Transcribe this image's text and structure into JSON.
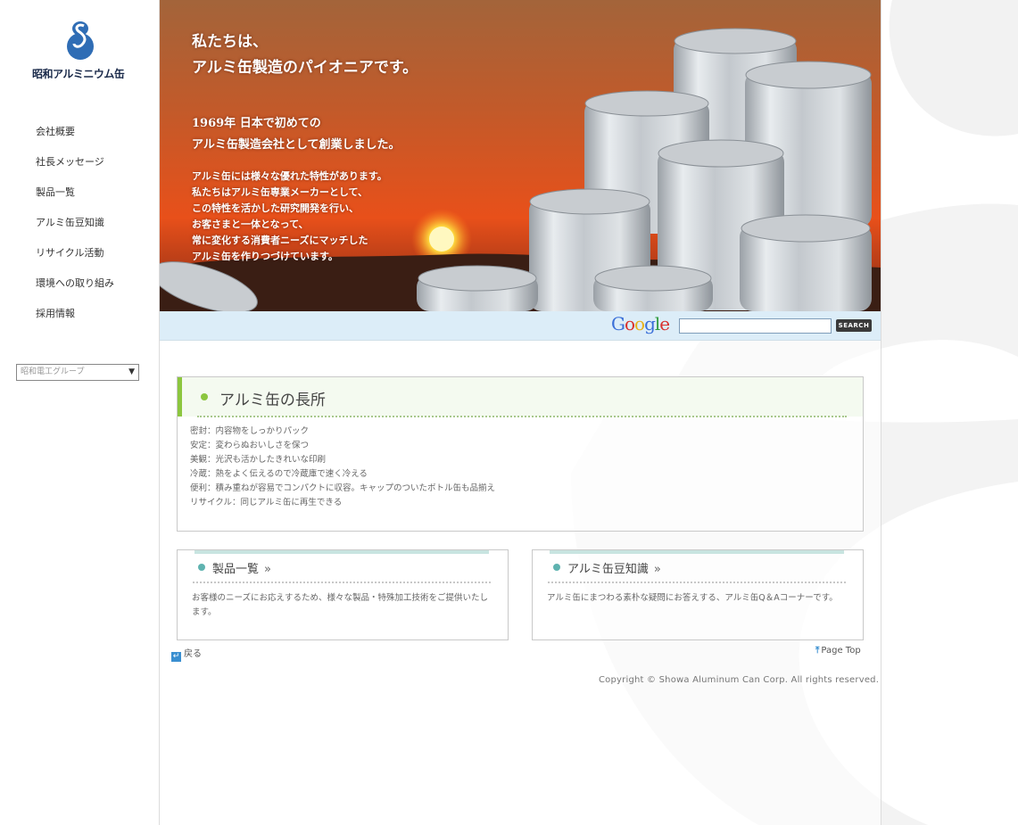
{
  "brand": {
    "name": "昭和アルミニウム缶"
  },
  "nav": {
    "items": [
      {
        "label": "会社概要"
      },
      {
        "label": "社長メッセージ"
      },
      {
        "label": "製品一覧"
      },
      {
        "label": "アルミ缶豆知識"
      },
      {
        "label": "リサイクル活動"
      },
      {
        "label": "環境への取り組み"
      },
      {
        "label": "採用情報"
      }
    ]
  },
  "group_select": {
    "selected": "昭和電工グループ"
  },
  "hero": {
    "headline": [
      "私たちは、",
      "アルミ缶製造のパイオニアです。"
    ],
    "subhead": [
      "1969年 日本で初めての",
      "アルミ缶製造会社として創業しました。"
    ],
    "body": [
      "アルミ缶には様々な優れた特性があります。",
      "私たちはアルミ缶専業メーカーとして、",
      "この特性を活かした研究開発を行い、",
      "お客さまと一体となって、",
      "常に変化する消費者ニーズにマッチした",
      "アルミ缶を作りつづけています。"
    ]
  },
  "search": {
    "logo": "Google",
    "value": "",
    "button": "SEARCH"
  },
  "merits": {
    "title": "アルミ缶の長所",
    "items": [
      "密封：内容物をしっかりパック",
      "安定：変わらぬおいしさを保つ",
      "美観：光沢も活かしたきれいな印刷",
      "冷蔵：熱をよく伝えるので冷蔵庫で速く冷える",
      "便利：積み重ねが容易でコンパクトに収容。キャップのついたボトル缶も品揃え",
      "リサイクル：同じアルミ缶に再生できる"
    ]
  },
  "cards": {
    "products": {
      "title": "製品一覧",
      "desc": "お客様のニーズにお応えするため、様々な製品・特殊加工技術をご提供いたします。"
    },
    "knowledge": {
      "title": "アルミ缶豆知識",
      "desc": "アルミ缶にまつわる素朴な疑問にお答えする、アルミ缶Q＆Aコーナーです。"
    }
  },
  "footer": {
    "back": "戻る",
    "page_top": "Page Top",
    "copyright": "Copyright © Showa Aluminum Can Corp. All rights reserved."
  },
  "colors": {
    "accent_green": "#8cc63f",
    "accent_teal": "#5fb3b0",
    "search_bar": "#dcedf8",
    "logo_blue": "#2f6db5"
  }
}
